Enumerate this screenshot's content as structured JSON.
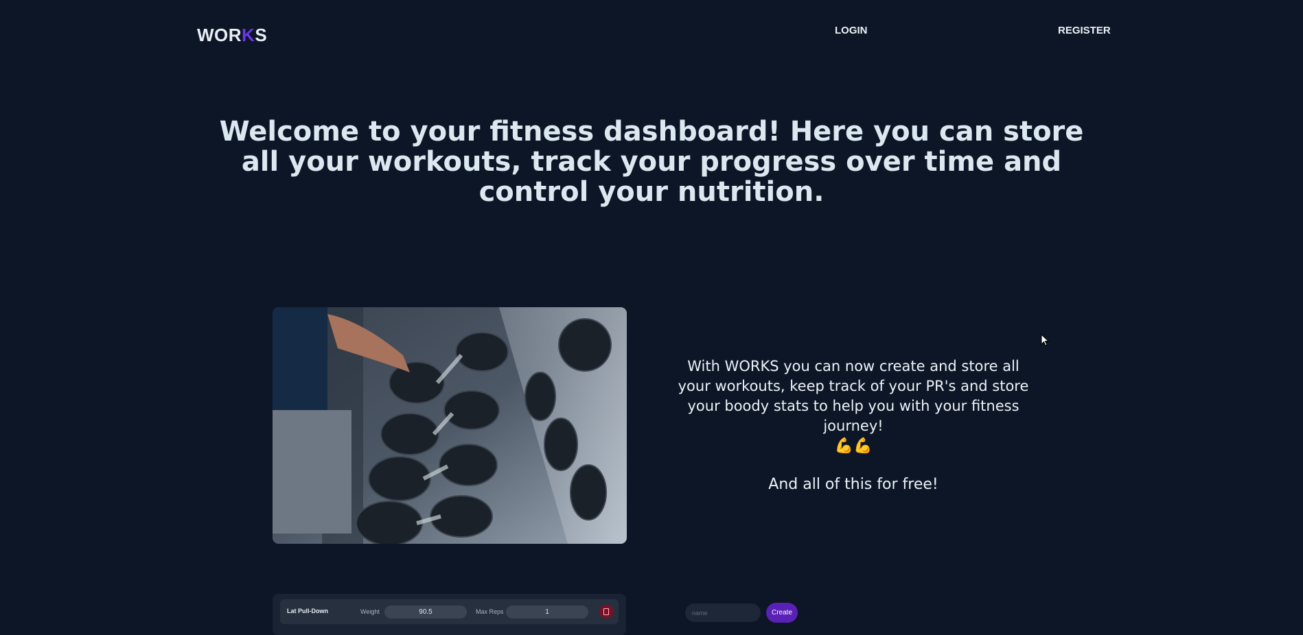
{
  "header": {
    "logo_prefix": "WOR",
    "logo_accent": "K",
    "logo_suffix": "S",
    "accent_color": "#6d35e6",
    "nav": {
      "login": "LOGIN",
      "register": "REGISTER"
    }
  },
  "hero": {
    "heading": "Welcome to your fitness dashboard! Here you can store all your workouts, track your progress over time and control your nutrition."
  },
  "feature": {
    "image_icon": "gym-dumbbell-rack-photo",
    "description": "With WORKS you can now create and store all your workouts, keep track of your PR's and store your boody stats to help you with your fitness journey!",
    "emoji": "💪💪",
    "tagline": "And all of this for free!"
  },
  "workout_preview": {
    "exercise": "Lat Pull-Down",
    "weight_label": "Weight",
    "weight_value": "90.5",
    "reps_label": "Max Reps",
    "reps_value": "1",
    "delete_icon": "trash-icon"
  },
  "create_form": {
    "name_placeholder": "name",
    "create_label": "Create"
  },
  "colors": {
    "background": "#0d1627",
    "accent": "#5a21b6",
    "delete": "#7a1028"
  }
}
